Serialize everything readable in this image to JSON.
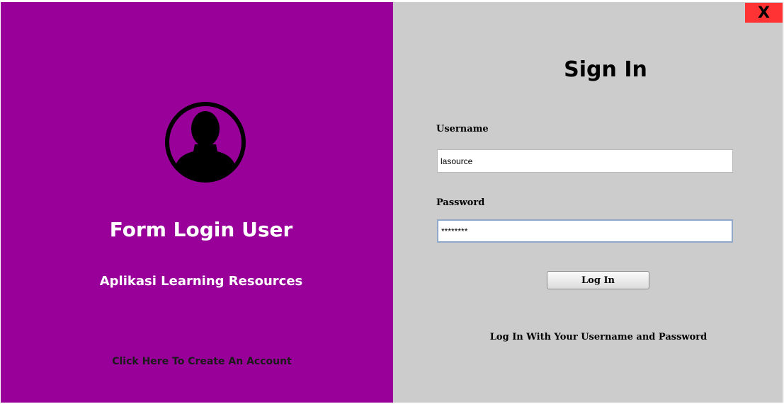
{
  "window": {
    "close_label": "X"
  },
  "left_panel": {
    "title": "Form Login User",
    "subtitle": "Aplikasi Learning Resources",
    "create_account_link": "Click Here To Create An Account",
    "icon": "user-avatar-icon"
  },
  "form": {
    "title": "Sign In",
    "username_label": "Username",
    "username_value": "lasource",
    "password_label": "Password",
    "password_value": "********",
    "login_button": "Log In",
    "hint": "Log In With Your Username and Password"
  },
  "colors": {
    "left_panel_bg": "#990099",
    "right_panel_bg": "#cccccc",
    "close_button_bg": "#ff3333"
  }
}
